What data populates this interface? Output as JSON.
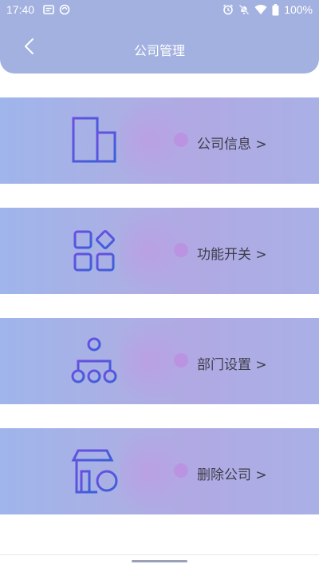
{
  "status_bar": {
    "time": "17:40",
    "left_icons": [
      "notification-icon",
      "sync-icon"
    ],
    "right_icons": [
      "alarm-icon",
      "mute-icon",
      "wifi-icon",
      "battery-icon"
    ],
    "battery": "100%"
  },
  "header": {
    "title": "公司管理",
    "back_icon": "chevron-left-icon",
    "background": "#a3b1e0"
  },
  "menu": [
    {
      "label": "公司信息 >",
      "icon": "building-icon"
    },
    {
      "label": "功能开关 >",
      "icon": "apps-grid-icon"
    },
    {
      "label": "部门设置 >",
      "icon": "org-chart-icon"
    },
    {
      "label": "删除公司 >",
      "icon": "store-remove-icon"
    }
  ],
  "colors": {
    "icon_gradient_start": "#6a4fe0",
    "icon_gradient_end": "#3b5fd9",
    "label_text": "#3d3d4a"
  }
}
